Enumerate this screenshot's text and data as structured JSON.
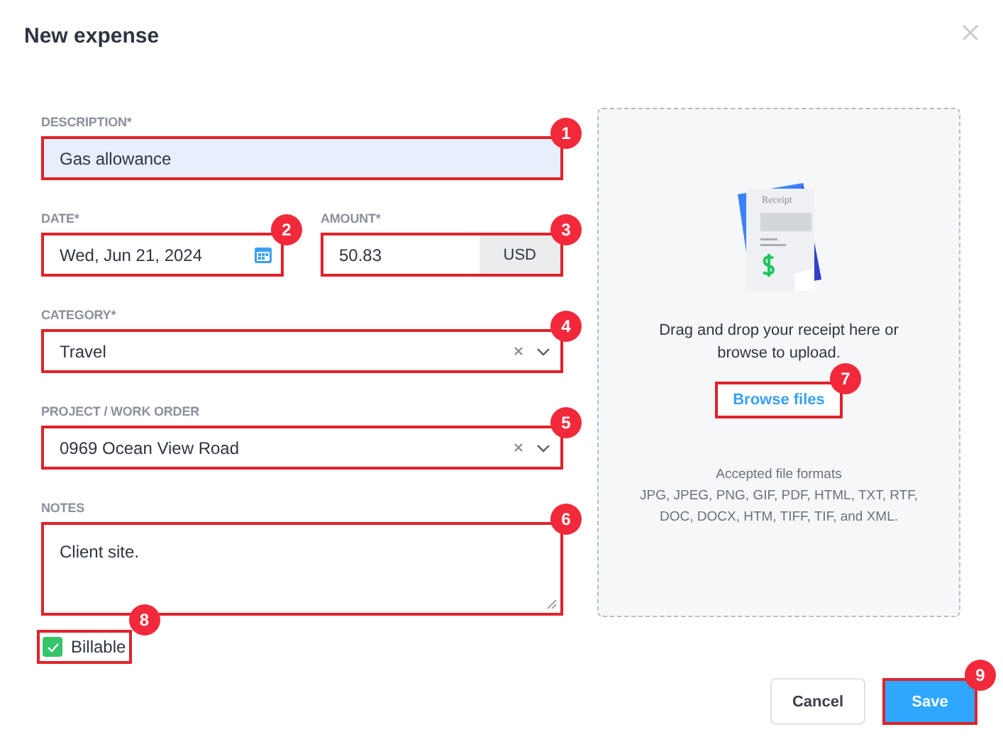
{
  "dialog": {
    "title": "New expense"
  },
  "fields": [
    {
      "kind": "text",
      "label": "DESCRIPTION*",
      "value": "Gas allowance",
      "filled": true,
      "callout": "1"
    },
    {
      "kind": "date",
      "label": "DATE*",
      "value": "Wed, Jun 21, 2024",
      "callout": "2"
    },
    {
      "kind": "amount",
      "label": "AMOUNT*",
      "value": "50.83",
      "currency": "USD",
      "callout": "3"
    },
    {
      "kind": "select",
      "label": "CATEGORY*",
      "value": "Travel",
      "callout": "4"
    },
    {
      "kind": "select",
      "label": "PROJECT / WORK ORDER",
      "value": "0969 Ocean View Road",
      "callout": "5"
    },
    {
      "kind": "textarea",
      "label": "NOTES",
      "value": "Client site.",
      "callout": "6"
    }
  ],
  "billable": {
    "label": "Billable",
    "checked": true,
    "callout": "8"
  },
  "upload": {
    "illustration_label": "Receipt",
    "prompt": "Drag and drop your receipt here or browse to upload.",
    "browse_button": "Browse files",
    "callout": "7",
    "formats_title": "Accepted file formats",
    "formats": "JPG, JPEG, PNG, GIF, PDF, HTML, TXT, RTF, DOC, DOCX, HTM, TIFF, TIF, and XML."
  },
  "buttons": [
    {
      "label": "Cancel",
      "kind": "secondary"
    },
    {
      "label": "Save",
      "kind": "primary",
      "callout": "9"
    }
  ]
}
